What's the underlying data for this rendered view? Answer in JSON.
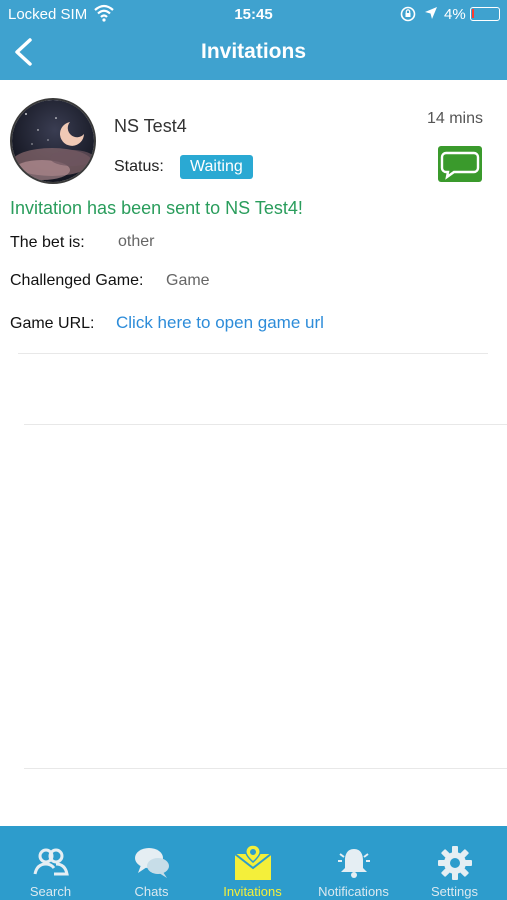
{
  "status_bar": {
    "carrier": "Locked SIM",
    "time": "15:45",
    "battery": "4%",
    "battery_level": 0.04
  },
  "nav": {
    "title": "Invitations",
    "back_icon": "chevron-left-icon"
  },
  "invitation": {
    "user_name": "NS Test4",
    "time_ago": "14 mins",
    "status_label": "Status:",
    "status_value": "Waiting",
    "sent_message": "Invitation has been sent to NS Test4!",
    "bet_label": "The bet is:",
    "bet_value": "other",
    "game_label": "Challenged Game:",
    "game_value": "Game",
    "url_label": "Game URL:",
    "url_link": "Click here to open game url"
  },
  "colors": {
    "header": "#3fa2cf",
    "tabbar": "#2d9ccc",
    "status_badge": "#2aa9d3",
    "sent_message": "#2a9d5c",
    "link": "#2d8cd9",
    "chat_button": "#3a9a2c",
    "active_tab": "#f4ef3a"
  },
  "tabs": [
    {
      "label": "Search",
      "icon": "users-search-icon",
      "active": false
    },
    {
      "label": "Chats",
      "icon": "chat-bubbles-icon",
      "active": false
    },
    {
      "label": "Invitations",
      "icon": "invitation-envelope-icon",
      "active": true
    },
    {
      "label": "Notifications",
      "icon": "bell-icon",
      "active": false
    },
    {
      "label": "Settings",
      "icon": "gear-icon",
      "active": false
    }
  ]
}
